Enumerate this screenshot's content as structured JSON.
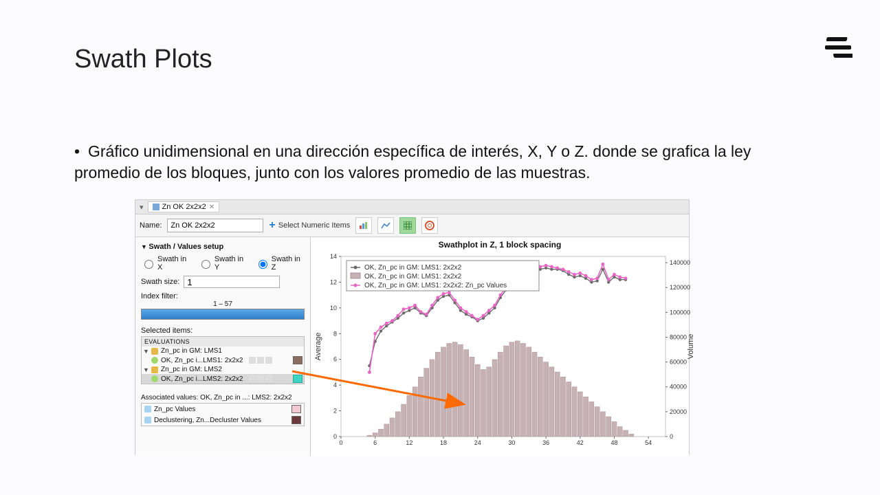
{
  "page": {
    "title": "Swath Plots",
    "bullet": "Gráfico unidimensional en una dirección específica de interés, X, Y o Z. donde se grafica la ley promedio de los bloques, junto con los valores promedio de las muestras."
  },
  "app": {
    "tab": {
      "label": "Zn OK 2x2x2"
    },
    "name_label": "Name:",
    "name_value": "Zn OK 2x2x2",
    "select_items": "Select Numeric Items",
    "section_header": "Swath / Values setup",
    "radios": {
      "x": "Swath in X",
      "y": "Swath in Y",
      "z": "Swath in Z",
      "selected": "z"
    },
    "swath_size_label": "Swath size:",
    "swath_size_value": "1",
    "index_filter_label": "Index filter:",
    "index_filter_range": "1 – 57",
    "selected_items_label": "Selected items:",
    "evals_header": "EVALUATIONS",
    "tree": {
      "lms1": "Zn_pc in GM: LMS1",
      "lms1_child": "OK, Zn_pc i...LMS1: 2x2x2",
      "lms2": "Zn_pc in GM: LMS2",
      "lms2_child": "OK, Zn_pc i...LMS2: 2x2x2"
    },
    "assoc_label": "Associated values:",
    "assoc_val": "OK, Zn_pc in ...: LMS2: 2x2x2",
    "assoc_row1": "Zn_pc Values",
    "assoc_row2": "Declustering, Zn...Decluster Values"
  },
  "chart_data": {
    "type": "bar+line",
    "title": "Swathplot in Z, 1 block spacing",
    "y_left_label": "Average",
    "y_right_label": "Volume",
    "x_categories": [
      0,
      6,
      12,
      18,
      24,
      30,
      36,
      42,
      48,
      54
    ],
    "y_left_ticks": [
      0,
      2,
      4,
      6,
      8,
      10,
      12,
      14
    ],
    "y_right_ticks": [
      0,
      20000,
      40000,
      60000,
      80000,
      100000,
      120000,
      140000
    ],
    "x_range": [
      0,
      57
    ],
    "y_left_range": [
      0,
      14
    ],
    "y_right_range": [
      0,
      145000
    ],
    "legend": [
      {
        "label": "OK, Zn_pc in GM: LMS1: 2x2x2",
        "type": "line",
        "color": "#6b6b6b"
      },
      {
        "label": "OK, Zn_pc in GM: LMS1: 2x2x2",
        "type": "bar",
        "color": "#c6b2b4"
      },
      {
        "label": "OK, Zn_pc in GM: LMS1: 2x2x2: Zn_pc Values",
        "type": "line",
        "color": "#e765c4"
      }
    ],
    "series_line_grey": [
      {
        "x": 5,
        "y": 5.5
      },
      {
        "x": 6,
        "y": 7.4
      },
      {
        "x": 7,
        "y": 8.2
      },
      {
        "x": 8,
        "y": 8.6
      },
      {
        "x": 9,
        "y": 8.9
      },
      {
        "x": 10,
        "y": 9.2
      },
      {
        "x": 11,
        "y": 9.6
      },
      {
        "x": 12,
        "y": 9.8
      },
      {
        "x": 13,
        "y": 10.0
      },
      {
        "x": 14,
        "y": 9.6
      },
      {
        "x": 15,
        "y": 9.4
      },
      {
        "x": 16,
        "y": 10.0
      },
      {
        "x": 17,
        "y": 10.6
      },
      {
        "x": 18,
        "y": 10.9
      },
      {
        "x": 19,
        "y": 11.0
      },
      {
        "x": 20,
        "y": 10.4
      },
      {
        "x": 21,
        "y": 9.8
      },
      {
        "x": 22,
        "y": 9.5
      },
      {
        "x": 23,
        "y": 9.3
      },
      {
        "x": 24,
        "y": 9.0
      },
      {
        "x": 25,
        "y": 9.2
      },
      {
        "x": 26,
        "y": 9.6
      },
      {
        "x": 27,
        "y": 10.0
      },
      {
        "x": 28,
        "y": 10.8
      },
      {
        "x": 29,
        "y": 11.4
      },
      {
        "x": 30,
        "y": 11.8
      },
      {
        "x": 31,
        "y": 12.0
      },
      {
        "x": 32,
        "y": 12.4
      },
      {
        "x": 33,
        "y": 12.6
      },
      {
        "x": 34,
        "y": 12.8
      },
      {
        "x": 35,
        "y": 13.0
      },
      {
        "x": 36,
        "y": 13.1
      },
      {
        "x": 37,
        "y": 13.0
      },
      {
        "x": 38,
        "y": 13.0
      },
      {
        "x": 39,
        "y": 12.9
      },
      {
        "x": 40,
        "y": 12.6
      },
      {
        "x": 41,
        "y": 12.4
      },
      {
        "x": 42,
        "y": 12.5
      },
      {
        "x": 43,
        "y": 12.3
      },
      {
        "x": 44,
        "y": 12.0
      },
      {
        "x": 45,
        "y": 12.1
      },
      {
        "x": 46,
        "y": 13.0
      },
      {
        "x": 47,
        "y": 12.0
      },
      {
        "x": 48,
        "y": 12.4
      },
      {
        "x": 49,
        "y": 12.2
      },
      {
        "x": 50,
        "y": 12.2
      }
    ],
    "series_line_pink": [
      {
        "x": 5,
        "y": 5.0
      },
      {
        "x": 6,
        "y": 8.0
      },
      {
        "x": 7,
        "y": 8.5
      },
      {
        "x": 8,
        "y": 8.8
      },
      {
        "x": 9,
        "y": 9.0
      },
      {
        "x": 10,
        "y": 9.4
      },
      {
        "x": 11,
        "y": 9.9
      },
      {
        "x": 12,
        "y": 10.0
      },
      {
        "x": 13,
        "y": 10.2
      },
      {
        "x": 14,
        "y": 9.7
      },
      {
        "x": 15,
        "y": 9.5
      },
      {
        "x": 16,
        "y": 10.2
      },
      {
        "x": 17,
        "y": 10.8
      },
      {
        "x": 18,
        "y": 11.1
      },
      {
        "x": 19,
        "y": 11.2
      },
      {
        "x": 20,
        "y": 10.6
      },
      {
        "x": 21,
        "y": 10.0
      },
      {
        "x": 22,
        "y": 9.7
      },
      {
        "x": 23,
        "y": 9.4
      },
      {
        "x": 24,
        "y": 9.1
      },
      {
        "x": 25,
        "y": 9.4
      },
      {
        "x": 26,
        "y": 9.8
      },
      {
        "x": 27,
        "y": 10.2
      },
      {
        "x": 28,
        "y": 11.0
      },
      {
        "x": 29,
        "y": 11.6
      },
      {
        "x": 30,
        "y": 12.0
      },
      {
        "x": 31,
        "y": 12.2
      },
      {
        "x": 32,
        "y": 12.6
      },
      {
        "x": 33,
        "y": 12.8
      },
      {
        "x": 34,
        "y": 13.0
      },
      {
        "x": 35,
        "y": 13.2
      },
      {
        "x": 36,
        "y": 13.3
      },
      {
        "x": 37,
        "y": 13.2
      },
      {
        "x": 38,
        "y": 13.1
      },
      {
        "x": 39,
        "y": 13.0
      },
      {
        "x": 40,
        "y": 12.8
      },
      {
        "x": 41,
        "y": 12.6
      },
      {
        "x": 42,
        "y": 12.7
      },
      {
        "x": 43,
        "y": 12.5
      },
      {
        "x": 44,
        "y": 12.2
      },
      {
        "x": 45,
        "y": 12.3
      },
      {
        "x": 46,
        "y": 13.4
      },
      {
        "x": 47,
        "y": 12.2
      },
      {
        "x": 48,
        "y": 12.6
      },
      {
        "x": 49,
        "y": 12.4
      },
      {
        "x": 50,
        "y": 12.3
      }
    ],
    "bars_volume": [
      {
        "x": 1,
        "v": 0
      },
      {
        "x": 2,
        "v": 0
      },
      {
        "x": 3,
        "v": 0
      },
      {
        "x": 4,
        "v": 0
      },
      {
        "x": 5,
        "v": 1000
      },
      {
        "x": 6,
        "v": 3000
      },
      {
        "x": 7,
        "v": 6000
      },
      {
        "x": 8,
        "v": 10000
      },
      {
        "x": 9,
        "v": 15000
      },
      {
        "x": 10,
        "v": 20000
      },
      {
        "x": 11,
        "v": 26000
      },
      {
        "x": 12,
        "v": 33000
      },
      {
        "x": 13,
        "v": 40000
      },
      {
        "x": 14,
        "v": 48000
      },
      {
        "x": 15,
        "v": 55000
      },
      {
        "x": 16,
        "v": 62000
      },
      {
        "x": 17,
        "v": 68000
      },
      {
        "x": 18,
        "v": 72000
      },
      {
        "x": 19,
        "v": 75000
      },
      {
        "x": 20,
        "v": 76000
      },
      {
        "x": 21,
        "v": 74000
      },
      {
        "x": 22,
        "v": 70000
      },
      {
        "x": 23,
        "v": 64000
      },
      {
        "x": 24,
        "v": 58000
      },
      {
        "x": 25,
        "v": 54000
      },
      {
        "x": 26,
        "v": 56000
      },
      {
        "x": 27,
        "v": 62000
      },
      {
        "x": 28,
        "v": 68000
      },
      {
        "x": 29,
        "v": 73000
      },
      {
        "x": 30,
        "v": 76000
      },
      {
        "x": 31,
        "v": 77000
      },
      {
        "x": 32,
        "v": 75000
      },
      {
        "x": 33,
        "v": 72000
      },
      {
        "x": 34,
        "v": 68000
      },
      {
        "x": 35,
        "v": 64000
      },
      {
        "x": 36,
        "v": 60000
      },
      {
        "x": 37,
        "v": 56000
      },
      {
        "x": 38,
        "v": 52000
      },
      {
        "x": 39,
        "v": 48000
      },
      {
        "x": 40,
        "v": 44000
      },
      {
        "x": 41,
        "v": 40000
      },
      {
        "x": 42,
        "v": 36000
      },
      {
        "x": 43,
        "v": 32000
      },
      {
        "x": 44,
        "v": 28000
      },
      {
        "x": 45,
        "v": 24000
      },
      {
        "x": 46,
        "v": 20000
      },
      {
        "x": 47,
        "v": 16000
      },
      {
        "x": 48,
        "v": 12000
      },
      {
        "x": 49,
        "v": 8000
      },
      {
        "x": 50,
        "v": 5000
      },
      {
        "x": 51,
        "v": 2000
      }
    ]
  }
}
